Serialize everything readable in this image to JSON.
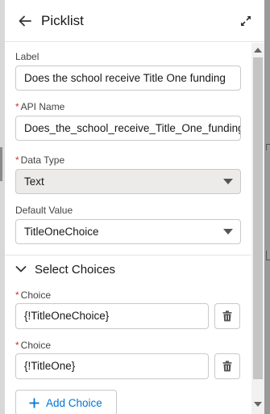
{
  "header": {
    "title": "Picklist"
  },
  "fields": {
    "label": {
      "label": "Label",
      "value": "Does the school receive Title One funding"
    },
    "api_name": {
      "label": "API Name",
      "required_mark": "*",
      "value": "Does_the_school_receive_Title_One_funding"
    },
    "data_type": {
      "label": "Data Type",
      "required_mark": "*",
      "value": "Text"
    },
    "default_value": {
      "label": "Default Value",
      "value": "TitleOneChoice"
    }
  },
  "choices_section": {
    "title": "Select Choices",
    "choices": [
      {
        "label": "Choice",
        "required_mark": "*",
        "value": "{!TitleOneChoice}"
      },
      {
        "label": "Choice",
        "required_mark": "*",
        "value": "{!TitleOne}"
      }
    ],
    "add_label": "Add Choice"
  },
  "icons": [
    "back-arrow-icon",
    "expand-icon",
    "chevron-down-icon",
    "trash-icon",
    "plus-icon"
  ],
  "colors": {
    "link": "#0176d3",
    "required": "#c23934",
    "disabled_bg": "#ecebea"
  }
}
